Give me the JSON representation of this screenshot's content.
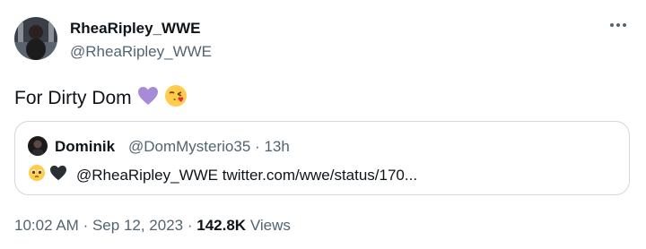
{
  "author": {
    "name": "RheaRipley_WWE",
    "handle": "@RheaRipley_WWE",
    "avatar_icon": "profile-photo"
  },
  "tweet": {
    "text": "For Dirty Dom",
    "emojis": [
      "purple-heart",
      "kissing-face-with-heart"
    ]
  },
  "quoted_tweet": {
    "name": "Dominik",
    "handle": "@DomMysterio35",
    "separator": "·",
    "time": "13h",
    "emojis": [
      "pleading-face",
      "black-heart"
    ],
    "text": "@RheaRipley_WWE twitter.com/wwe/status/170..."
  },
  "meta": {
    "time": "10:02 AM",
    "sep1": "·",
    "date": "Sep 12, 2023",
    "sep2": "·",
    "views_count": "142.8K",
    "views_label": "Views"
  },
  "colors": {
    "text": "#0f1419",
    "secondary": "#536471",
    "border": "#cfd9de",
    "purple_heart": "#a78bd8"
  }
}
